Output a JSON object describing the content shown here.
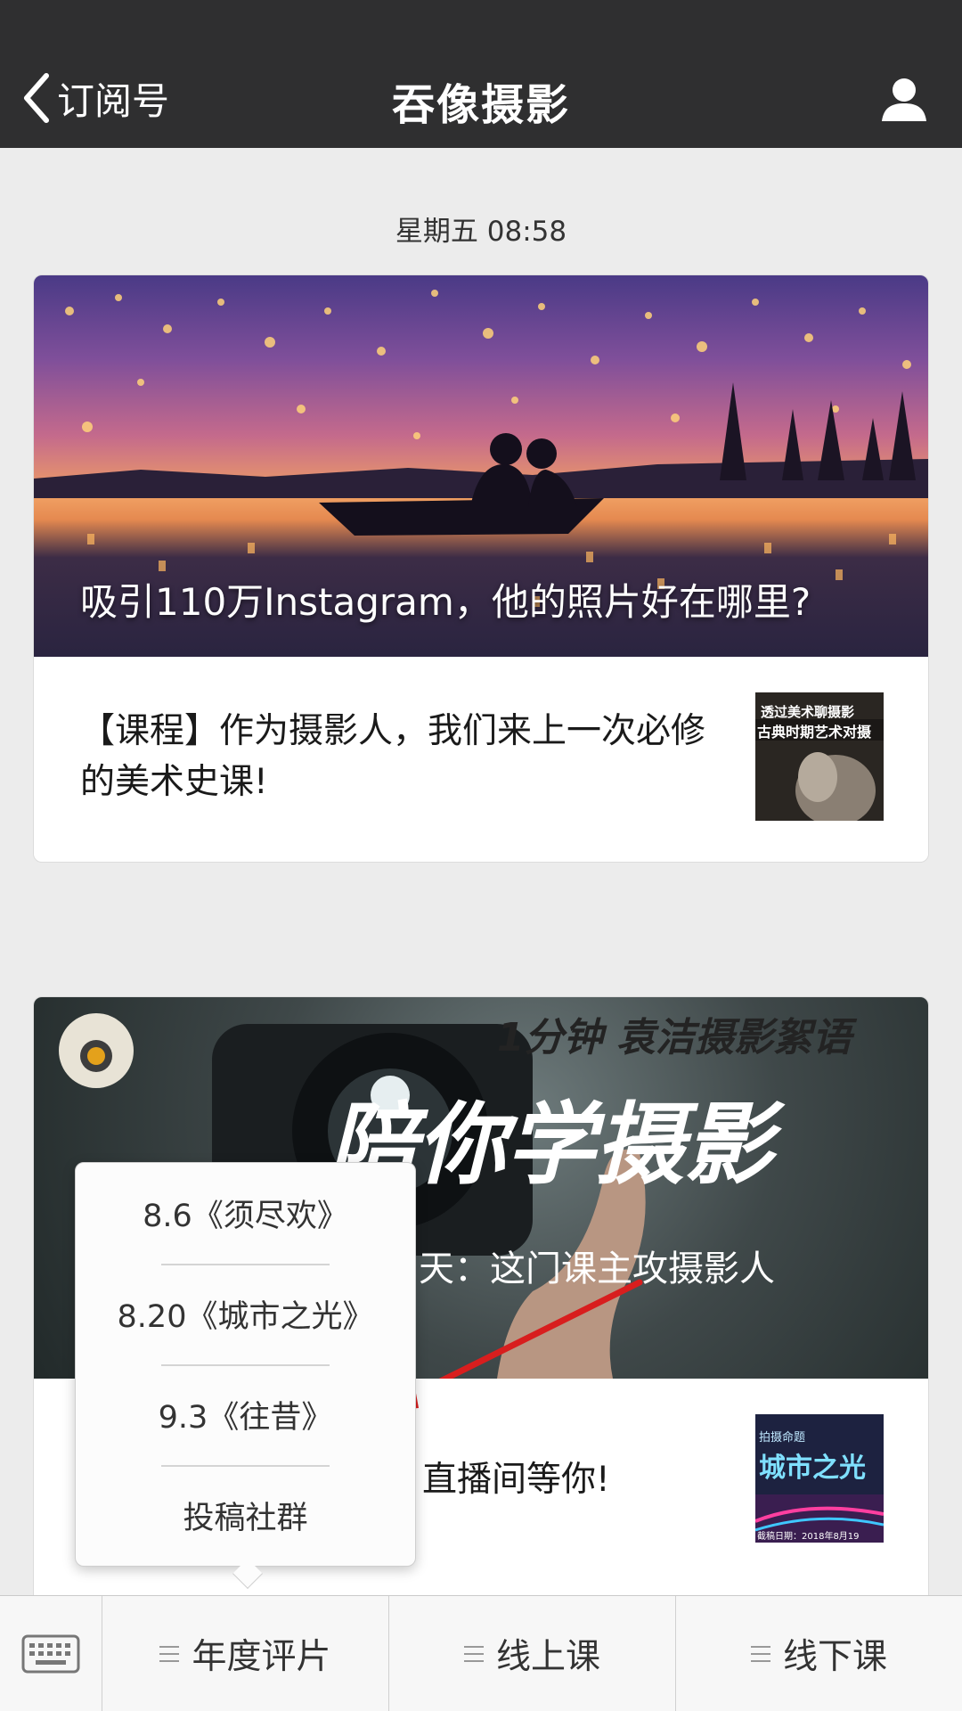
{
  "navbar": {
    "back_label": "订阅号",
    "title": "吞像摄影"
  },
  "feed": {
    "timestamp": "星期五 08:58",
    "card1": {
      "cover_title": "吸引110万Instagram，他的照片好在哪里?",
      "item_text": "【课程】作为摄影人，我们来上一次必修的美术史课!",
      "thumb_line1": "透过美术聊摄影",
      "thumb_line2": "古典时期艺术对摄"
    },
    "card2": {
      "cover_line1": "1分钟 袁洁摄影絮语",
      "cover_line2": "陪你学摄影",
      "cover_line3": "天：这门课主攻摄影人",
      "item_text": "直播间等你!",
      "thumb_tag": "拍摄命题",
      "thumb_line1": "城市之光",
      "thumb_line2": "截稿日期：2018年8月19"
    }
  },
  "popup_menu": {
    "items": [
      "8.6《须尽欢》",
      "8.20《城市之光》",
      "9.3《往昔》",
      "投稿社群"
    ]
  },
  "bottom_menu": {
    "items": [
      "年度评片",
      "线上课",
      "线下课"
    ]
  },
  "colors": {
    "navbar": "#2f2f30",
    "background": "#ececec",
    "annotation_arrow": "#d81e1e"
  },
  "icons": {
    "back": "chevron-left-icon",
    "profile": "person-icon",
    "keyboard": "keyboard-icon",
    "menu": "menu-lines-icon"
  }
}
